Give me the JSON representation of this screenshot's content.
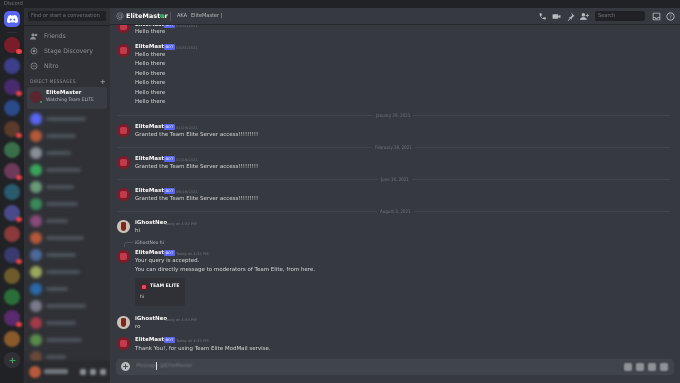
{
  "app": {
    "name": "Discord"
  },
  "sidebar": {
    "search_placeholder": "Find or start a conversation",
    "nav": [
      {
        "label": "Friends",
        "icon": "friends-icon"
      },
      {
        "label": "Stage Discovery",
        "icon": "stage-icon"
      },
      {
        "label": "Nitro",
        "icon": "nitro-icon"
      }
    ],
    "dm_header": "DIRECT MESSAGES",
    "add_dm_symbol": "+",
    "active_dm": {
      "name": "EliteMaster",
      "status": "Watching Team ELITE"
    }
  },
  "header": {
    "name": "EliteMaster",
    "sub1": "AKA",
    "sub2": "EliteMaster |",
    "search_placeholder": "Search"
  },
  "bot_badge": "BOT",
  "messages": {
    "top_partial": {
      "author": "EliteMaster",
      "time": "03/31/2021"
    },
    "g1": {
      "author": "EliteMaster",
      "time": "03/31/2021",
      "lines": [
        "Hello there",
        "Hello there",
        "Hello there",
        "Hello there",
        "Hello there",
        "Hello there",
        "Hello there"
      ]
    },
    "sep1": "January 29, 2021",
    "g2": {
      "author": "EliteMaster",
      "time": "01/29/2021",
      "text": "Granted the Team Elite Server access!!!!!!!!!"
    },
    "sep2": "February 28, 2021",
    "g3": {
      "author": "EliteMaster",
      "time": "02/28/2021",
      "text": "Granted the Team Elite Server access!!!!!!!!!"
    },
    "sep3": "June 16, 2021",
    "g4": {
      "author": "EliteMaster",
      "time": "06/16/2021",
      "text": ""
    },
    "sep4": "August 3, 2021",
    "g5": {
      "author": "iGhostNeo",
      "time": "Today at 4:32 PM",
      "text": "hi"
    },
    "g6": {
      "reply_author": "iGhostNeo",
      "reply_text": "hi",
      "author": "EliteMaster",
      "time": "Today at 4:32 PM",
      "lines": [
        "Your query is accepted.",
        "You can directly message to moderators of Team Elite, from here."
      ],
      "embed_title": "TEAM ELITE",
      "embed_body": "hi"
    },
    "g7": {
      "author": "iGhostNeo",
      "time": "Today at 4:33 PM",
      "text": "ro"
    },
    "g8": {
      "author": "EliteMaster",
      "time": "Today at 4:33 PM",
      "text": "Thank You!, for using Team Elite ModMail servise."
    }
  },
  "composer": {
    "placeholder": "Message @EliteMaster"
  }
}
